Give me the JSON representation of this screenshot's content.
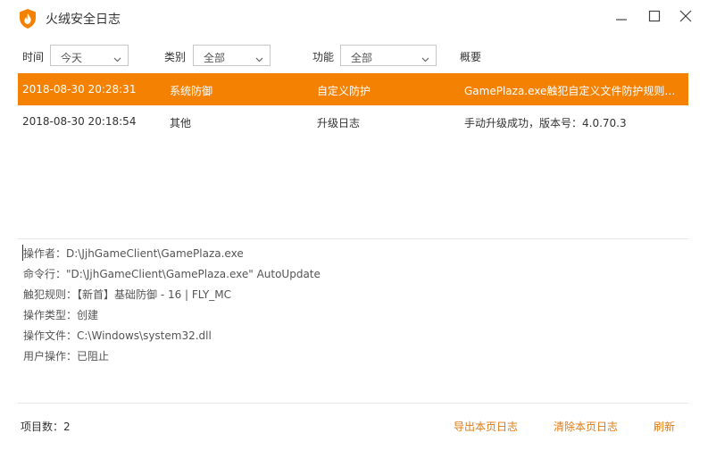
{
  "window": {
    "title": "火绒安全日志",
    "logo_icon": "huorong-shield-flame-icon",
    "accent_color": "#f58103",
    "controls": {
      "minimize_icon": "minimize-icon",
      "maximize_icon": "maximize-icon",
      "close_icon": "close-icon"
    }
  },
  "filters": {
    "time": {
      "label": "时间",
      "value": "今天"
    },
    "category": {
      "label": "类别",
      "value": "全部"
    },
    "function": {
      "label": "功能",
      "value": "全部"
    },
    "summary_header": "概要"
  },
  "rows": [
    {
      "time": "2018-08-30 20:28:31",
      "category": "系统防御",
      "function": "自定义防护",
      "summary": "GamePlaza.exe触犯自定义文件防护规则, ...",
      "selected": true
    },
    {
      "time": "2018-08-30 20:18:54",
      "category": "其他",
      "function": "升级日志",
      "summary": "手动升级成功，版本号：4.0.70.3",
      "selected": false
    }
  ],
  "details": [
    "操作者：D:\\JjhGameClient\\GamePlaza.exe",
    "命令行：\"D:\\JjhGameClient\\GamePlaza.exe\" AutoUpdate",
    "触犯规则：【新首】基础防御 - 16 | FLY_MC",
    "操作类型：创建",
    "操作文件：C:\\Windows\\system32.dll",
    "用户操作：已阻止"
  ],
  "footer": {
    "count": "项目数：2",
    "export_label": "导出本页日志",
    "clear_label": "清除本页日志",
    "refresh_label": "刷新",
    "link_color": "#e07a12"
  }
}
